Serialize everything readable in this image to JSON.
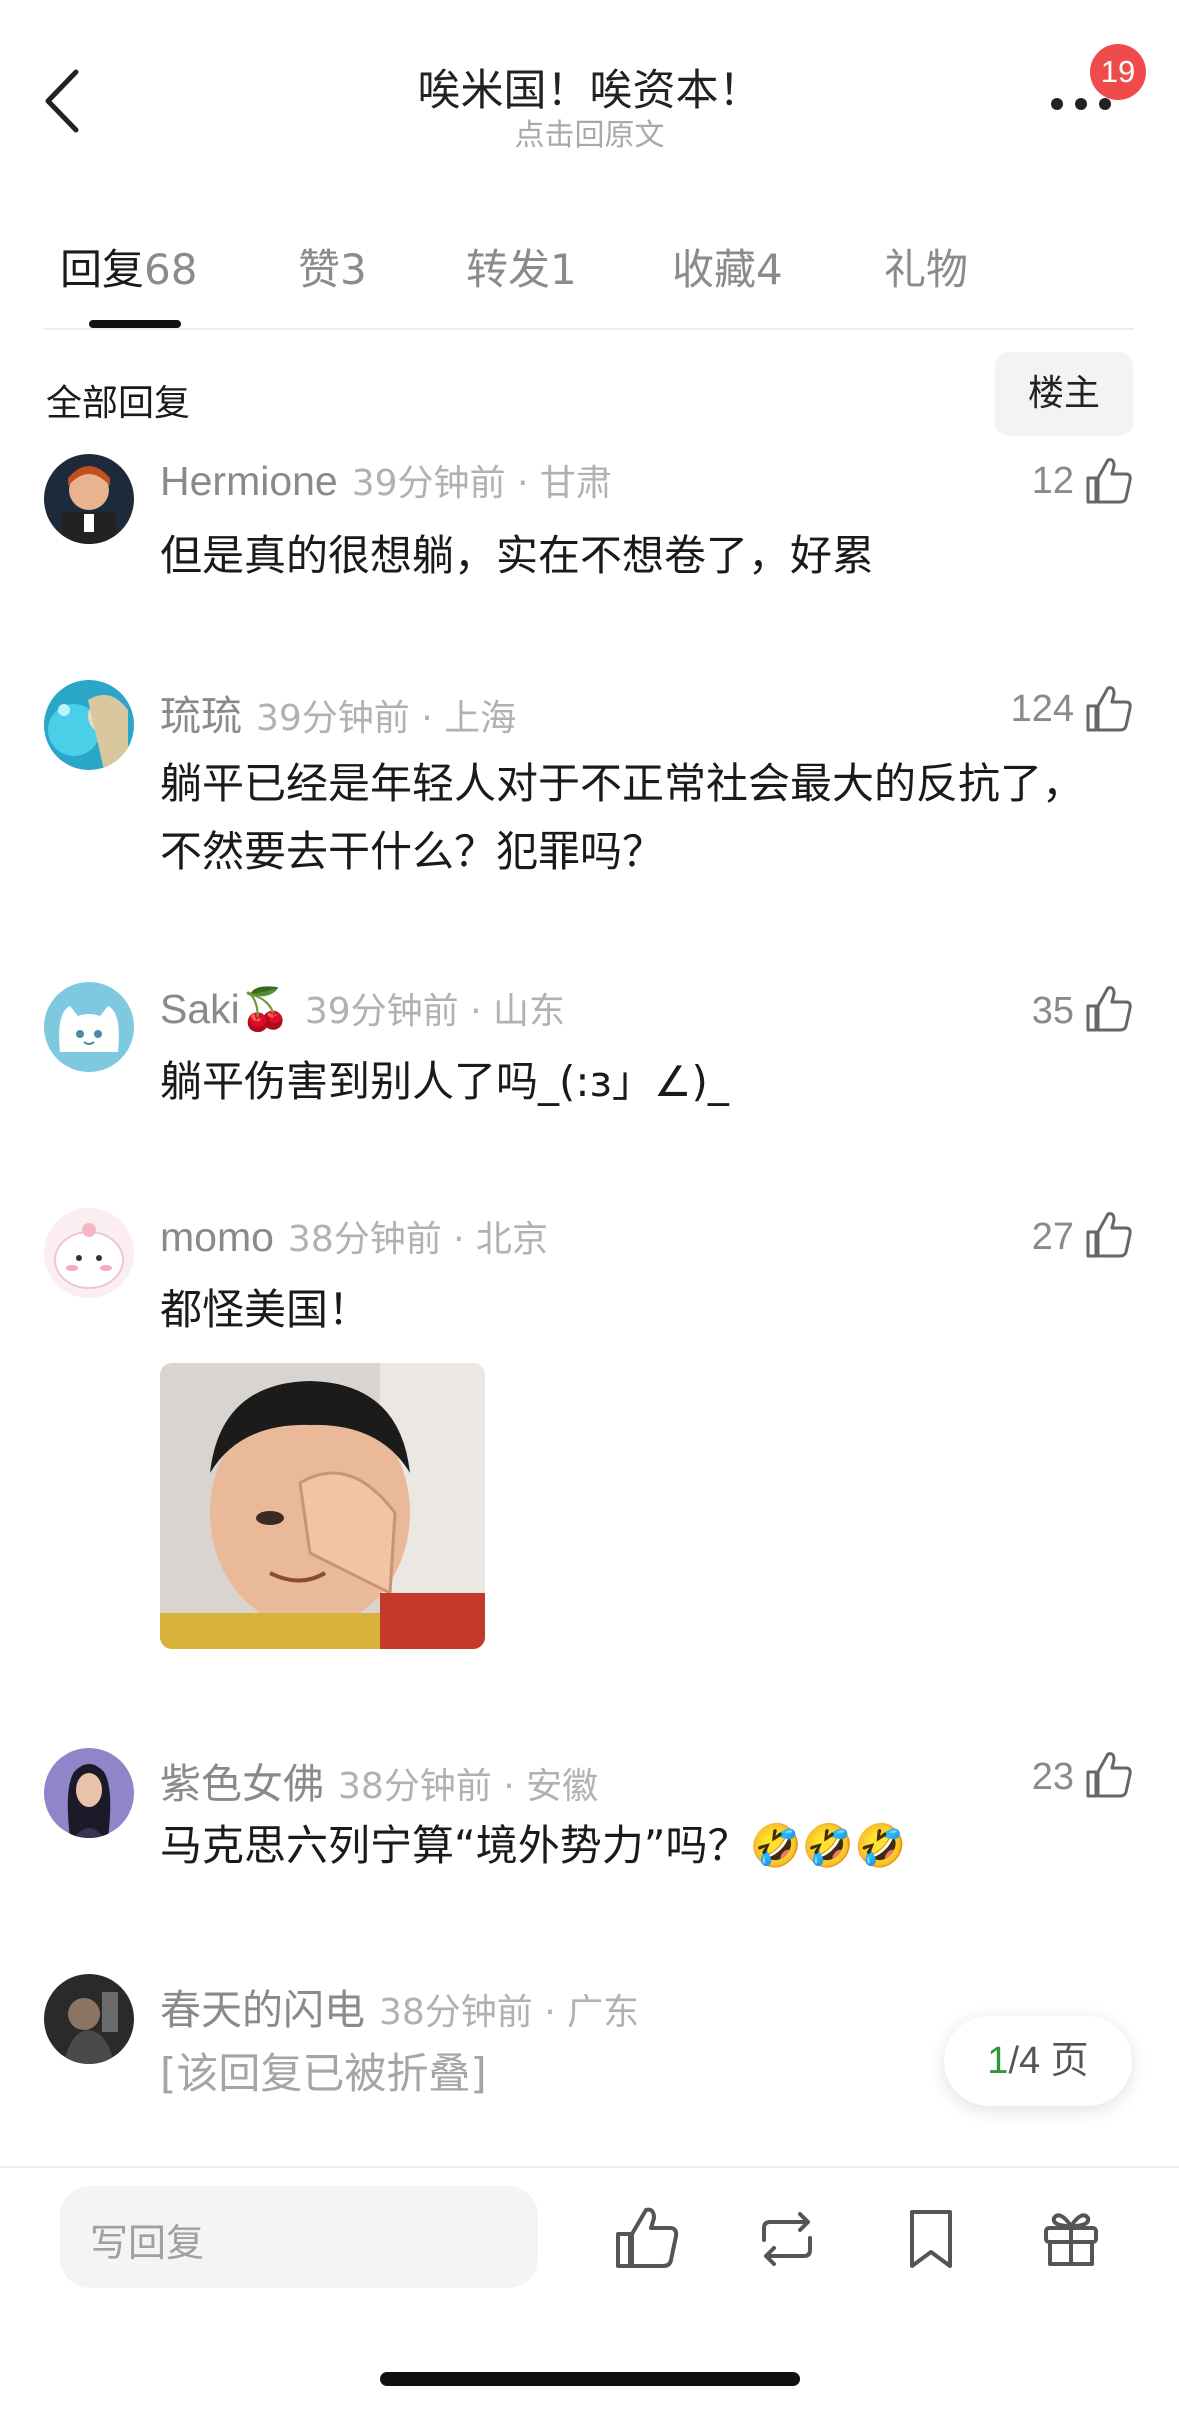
{
  "header": {
    "title": "唉米国！唉资本！",
    "subtitle": "点击回原文",
    "badge": "19"
  },
  "tabs": [
    {
      "label": "回复",
      "count": "68",
      "active": true
    },
    {
      "label": "赞",
      "count": "3"
    },
    {
      "label": "转发",
      "count": "1"
    },
    {
      "label": "收藏",
      "count": "4"
    },
    {
      "label": "礼物",
      "count": ""
    }
  ],
  "filter": {
    "all_replies": "全部回复",
    "louzhu": "楼主"
  },
  "comments": [
    {
      "name": "Hermione",
      "meta": "39分钟前 · 甘肃",
      "likes": "12",
      "text": "但是真的很想躺，实在不想卷了，好累"
    },
    {
      "name": "琉琉",
      "meta": "39分钟前 · 上海",
      "likes": "124",
      "text": "躺平已经是年轻人对于不正常社会最大的反抗了，不然要去干什么？犯罪吗？"
    },
    {
      "name": "Saki🍒",
      "meta": "39分钟前 · 山东",
      "likes": "35",
      "text": "躺平伤害到别人了吗_(:з」∠)_"
    },
    {
      "name": "momo",
      "meta": "38分钟前 · 北京",
      "likes": "27",
      "text": "都怪美国！"
    },
    {
      "name": "紫色女佛",
      "meta": "38分钟前 · 安徽",
      "likes": "23",
      "text": "马克思六列宁算“境外势力”吗？🤣🤣🤣"
    },
    {
      "name": "春天的闪电",
      "meta": "38分钟前 · 广东",
      "likes": "",
      "text": "[该回复已被折叠]"
    }
  ],
  "pager": {
    "current": "1",
    "total": "/4 页"
  },
  "bottom_bar": {
    "reply_placeholder": "写回复"
  },
  "colors": {
    "accent_green": "#2b9a3f",
    "badge_red": "#f04b4b"
  }
}
